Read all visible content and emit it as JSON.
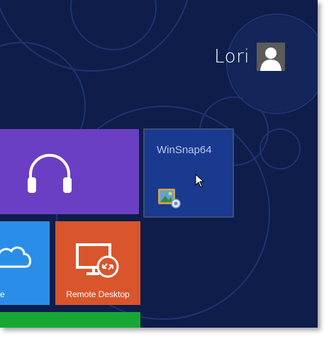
{
  "user": {
    "name": "Lori",
    "avatar_icon": "user-avatar-icon"
  },
  "tiles": {
    "music": {
      "icon": "headphones-icon",
      "color": "#6b3fc3"
    },
    "winsnap": {
      "label": "WinSnap64",
      "icon": "winsnap-app-icon",
      "color": "#1a3a8f"
    },
    "skydrive": {
      "label": "ve",
      "icon": "cloud-icon",
      "color": "#2a8ee8"
    },
    "remote_desktop": {
      "label": "Remote Desktop",
      "icon": "remote-desktop-icon",
      "color": "#d9552c"
    },
    "green": {
      "color": "#17a735"
    }
  },
  "cursor": {
    "icon": "mouse-pointer-icon"
  },
  "background": {
    "color": "#0e1d4a"
  }
}
